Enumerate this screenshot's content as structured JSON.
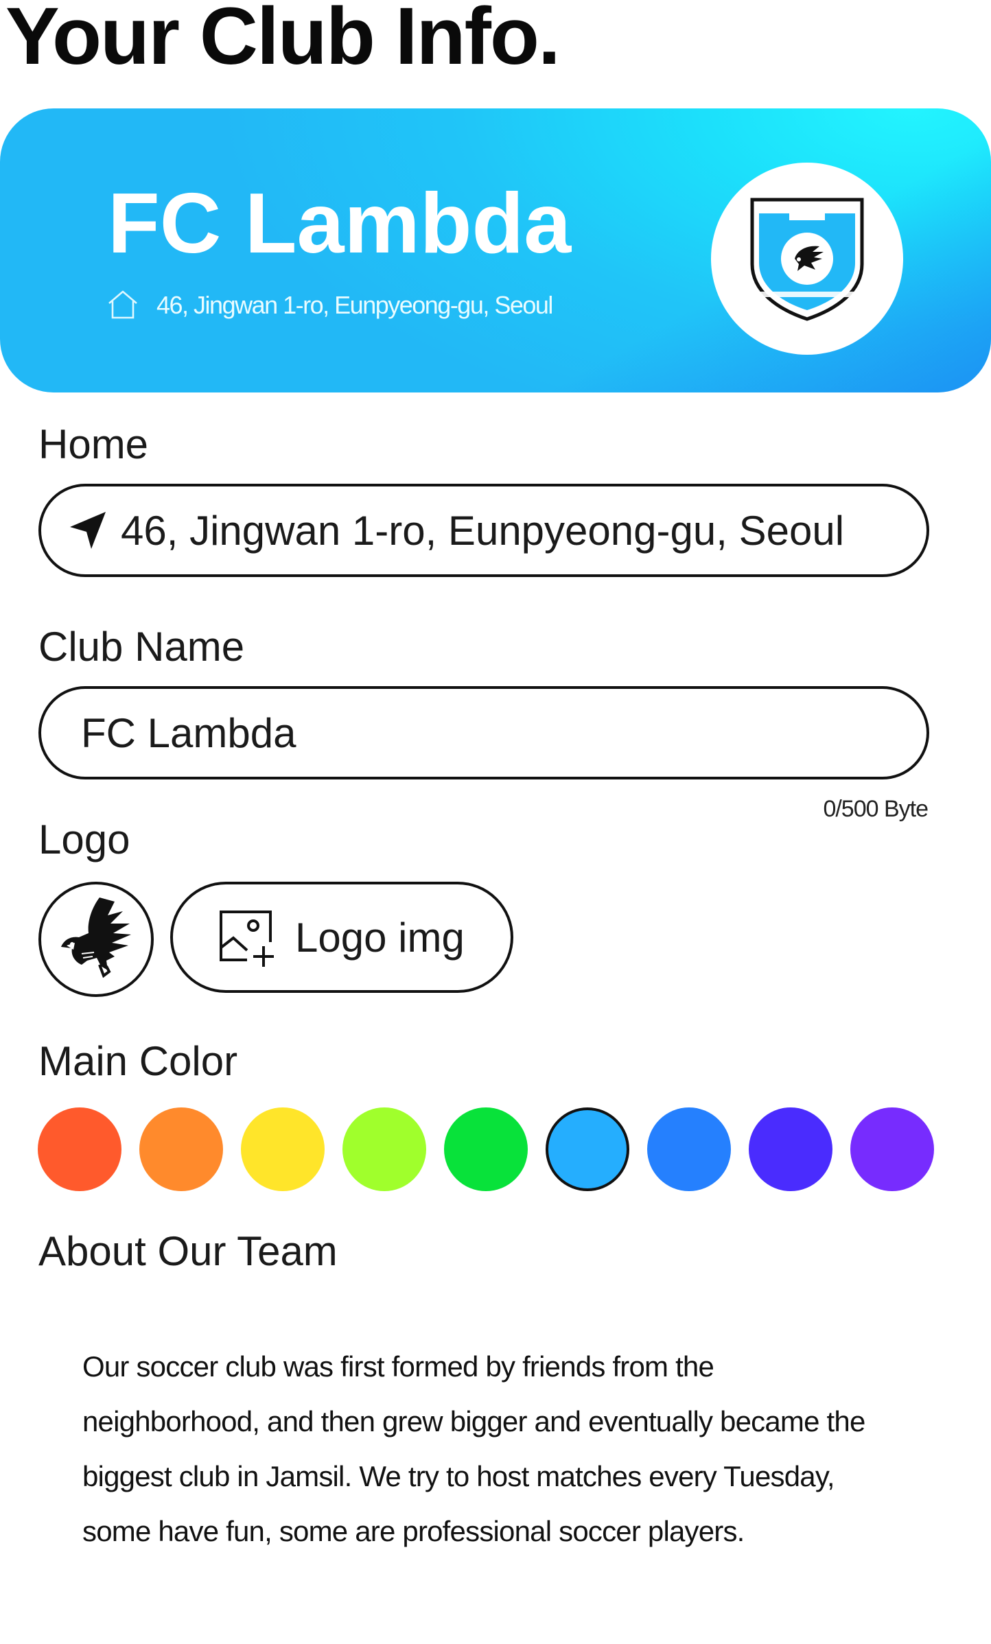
{
  "page": {
    "title": "Your Club Info."
  },
  "hero": {
    "club_name": "FC Lambda",
    "address": "46, Jingwan 1-ro, Eunpyeong-gu, Seoul",
    "home_icon": "home-icon",
    "badge_icon": "club-crest-icon"
  },
  "form": {
    "home": {
      "label": "Home",
      "value": "46, Jingwan 1-ro, Eunpyeong-gu, Seoul",
      "icon": "location-arrow-icon"
    },
    "club_name": {
      "label": "Club Name",
      "value": "FC Lambda",
      "counter": "0/500 Byte"
    },
    "logo": {
      "label": "Logo",
      "preview_icon": "falcon-logo-icon",
      "upload_label": "Logo img",
      "upload_icon": "add-image-icon"
    },
    "main_color": {
      "label": "Main Color",
      "swatches": [
        "#ff5a2c",
        "#ff8a2c",
        "#ffe52a",
        "#a0ff2c",
        "#08e23a",
        "#25aefe",
        "#2580fe",
        "#4a2cfe",
        "#772cfe"
      ],
      "selected_index": 5
    },
    "about": {
      "label": "About Our Team",
      "text": "Our soccer club was first formed by friends from the neighborhood, and then grew bigger and eventually became the biggest club in Jamsil. We try to host matches every Tuesday, some have fun, some are professional soccer players."
    }
  },
  "colors": {
    "accent": "#22c6f8",
    "accent_light": "#22f4ff",
    "border": "#111111"
  }
}
